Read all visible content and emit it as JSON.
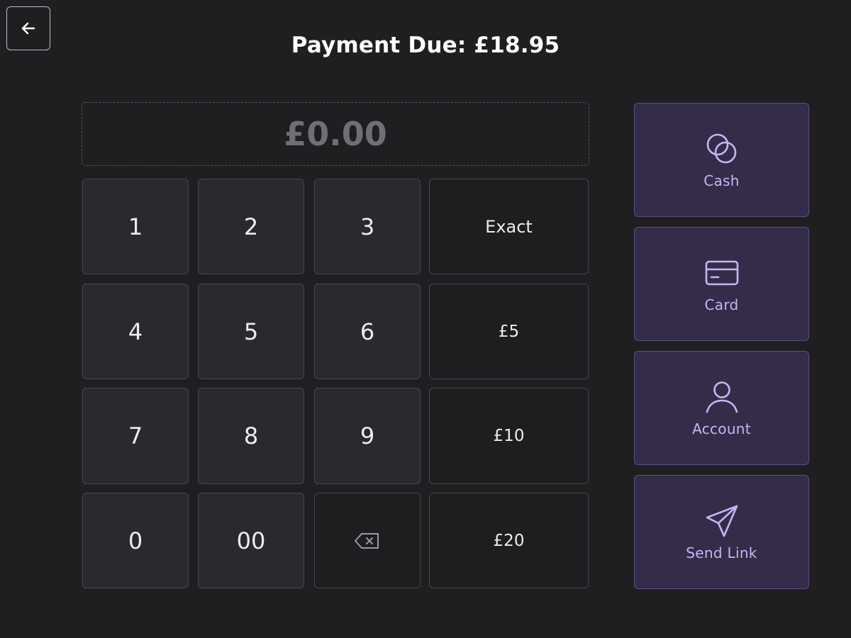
{
  "header": {
    "title": "Payment Due: £18.95",
    "back_icon": "arrow-left-icon"
  },
  "amount_display": {
    "value": "£0.00"
  },
  "keypad": {
    "digits": [
      "1",
      "2",
      "3",
      "4",
      "5",
      "6",
      "7",
      "8",
      "9",
      "0",
      "00"
    ],
    "backspace_icon": "backspace-icon",
    "quick_amounts": [
      "Exact",
      "£5",
      "£10",
      "£20"
    ]
  },
  "payment_methods": [
    {
      "label": "Cash",
      "icon": "coins-icon"
    },
    {
      "label": "Card",
      "icon": "credit-card-icon"
    },
    {
      "label": "Account",
      "icon": "user-icon"
    },
    {
      "label": "Send Link",
      "icon": "send-icon"
    }
  ],
  "colors": {
    "background": "#1f1f21",
    "accent": "#c5b6f2",
    "payment_button_bg": "#342c49"
  }
}
